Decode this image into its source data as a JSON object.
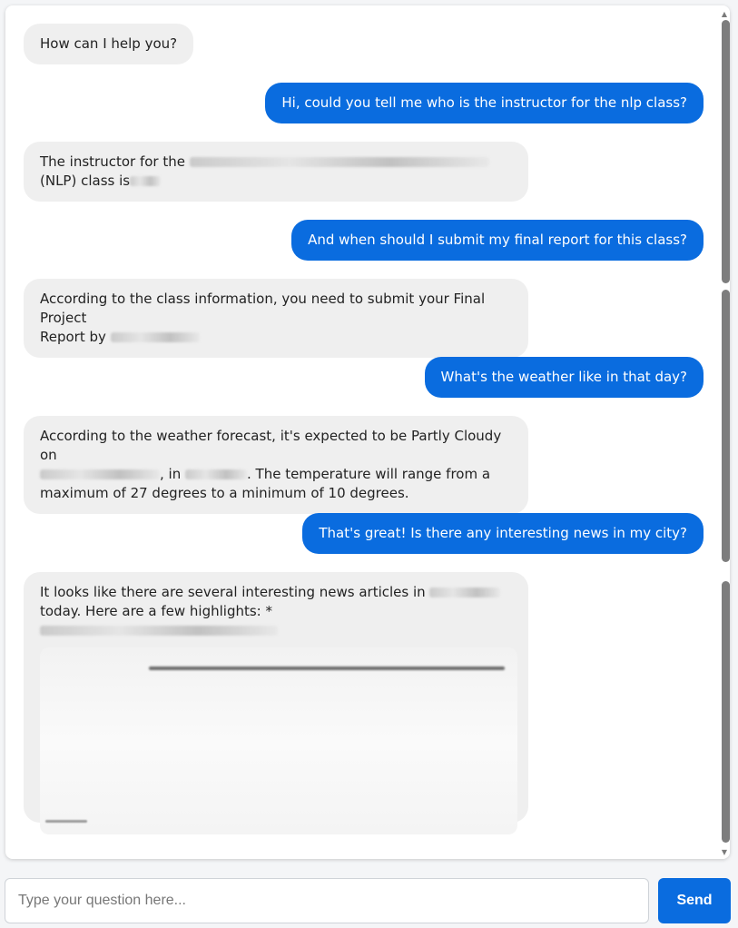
{
  "theme": {
    "user_bubble": "#0a6cdf",
    "bot_bubble": "#efefef",
    "send_button": "#0a6cdf"
  },
  "messages": [
    {
      "role": "bot",
      "text": "How can I help you?"
    },
    {
      "role": "user",
      "text": "Hi, could you tell me who is the instructor for the nlp class?"
    },
    {
      "role": "bot",
      "text_a": "The instructor for the",
      "text_b": "(NLP) class is"
    },
    {
      "role": "user",
      "text": "And when should I submit my final report for this class?"
    },
    {
      "role": "bot",
      "text_a": "According to the class information, you need to submit your Final Project",
      "text_b": "Report by"
    },
    {
      "role": "user",
      "text": "What's the weather like in that day?"
    },
    {
      "role": "bot",
      "text_a": "According to the weather forecast, it's expected to be Partly Cloudy on",
      "text_b": ", in",
      "text_c": ". The temperature will range from a",
      "text_d": "maximum of 27 degrees to a minimum of 10 degrees."
    },
    {
      "role": "user",
      "text": "That's great! Is there any interesting news in my city?"
    },
    {
      "role": "bot",
      "text_a": "It looks like there are several interesting news articles in",
      "text_b": "today. Here are a few highlights: *"
    }
  ],
  "composer": {
    "placeholder": "Type your question here...",
    "send_label": "Send"
  }
}
